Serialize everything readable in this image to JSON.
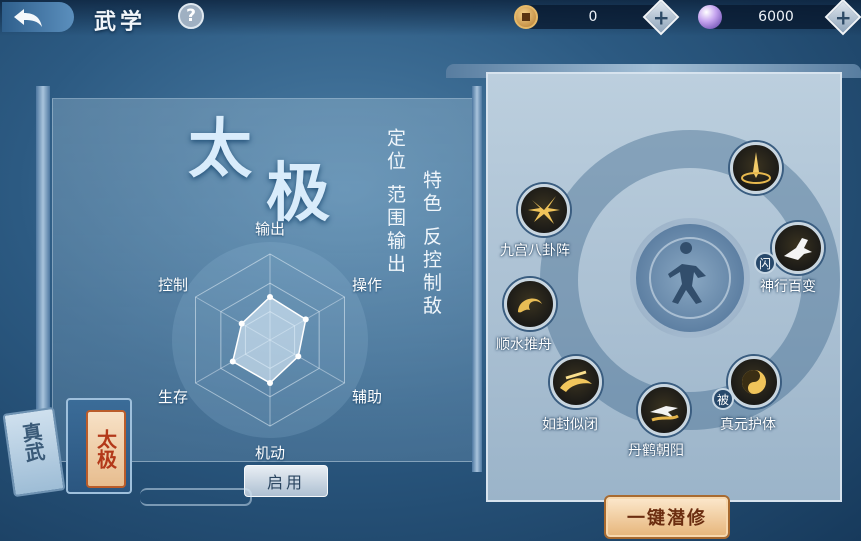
{
  "header": {
    "back_icon": "back-arrow-icon",
    "title": "武学",
    "help_label": "?"
  },
  "currency": {
    "copper": {
      "icon": "copper-coin-icon",
      "value": "0",
      "add_label": "+"
    },
    "pearl": {
      "icon": "purple-pearl-icon",
      "value": "6000",
      "add_label": "+"
    }
  },
  "martial_style": {
    "name_1": "太",
    "name_2": "极",
    "role_text": "定位 范围输出",
    "trait_text": "特色 反控制敌",
    "radar": {
      "axes": [
        "输出",
        "操作",
        "辅助",
        "机动",
        "生存",
        "控制"
      ],
      "values": [
        0.5,
        0.48,
        0.38,
        0.5,
        0.5,
        0.38
      ]
    },
    "enable_label": "启用"
  },
  "style_tabs": [
    {
      "label": "太极",
      "active": true
    },
    {
      "label": "真武",
      "active": false
    }
  ],
  "skills": [
    {
      "name": "",
      "icon": "golden-sword-icon"
    },
    {
      "name": "九宫八卦阵",
      "icon": "bagua-burst-icon"
    },
    {
      "name": "神行百变",
      "icon": "dash-figure-icon",
      "tag": "闪"
    },
    {
      "name": "顺水推舟",
      "icon": "taiji-swirl-icon"
    },
    {
      "name": "如封似闭",
      "icon": "golden-wave-icon"
    },
    {
      "name": "丹鹤朝阳",
      "icon": "crane-strike-icon"
    },
    {
      "name": "真元护体",
      "icon": "yinyang-shield-icon",
      "tag": "被"
    }
  ],
  "cultivate_label": "一键潜修",
  "colors": {
    "accent_gold": "#e6b968",
    "button_orange": "#e7b77d",
    "tab_red": "#b3391a",
    "panel_blue": "#bccfde"
  }
}
